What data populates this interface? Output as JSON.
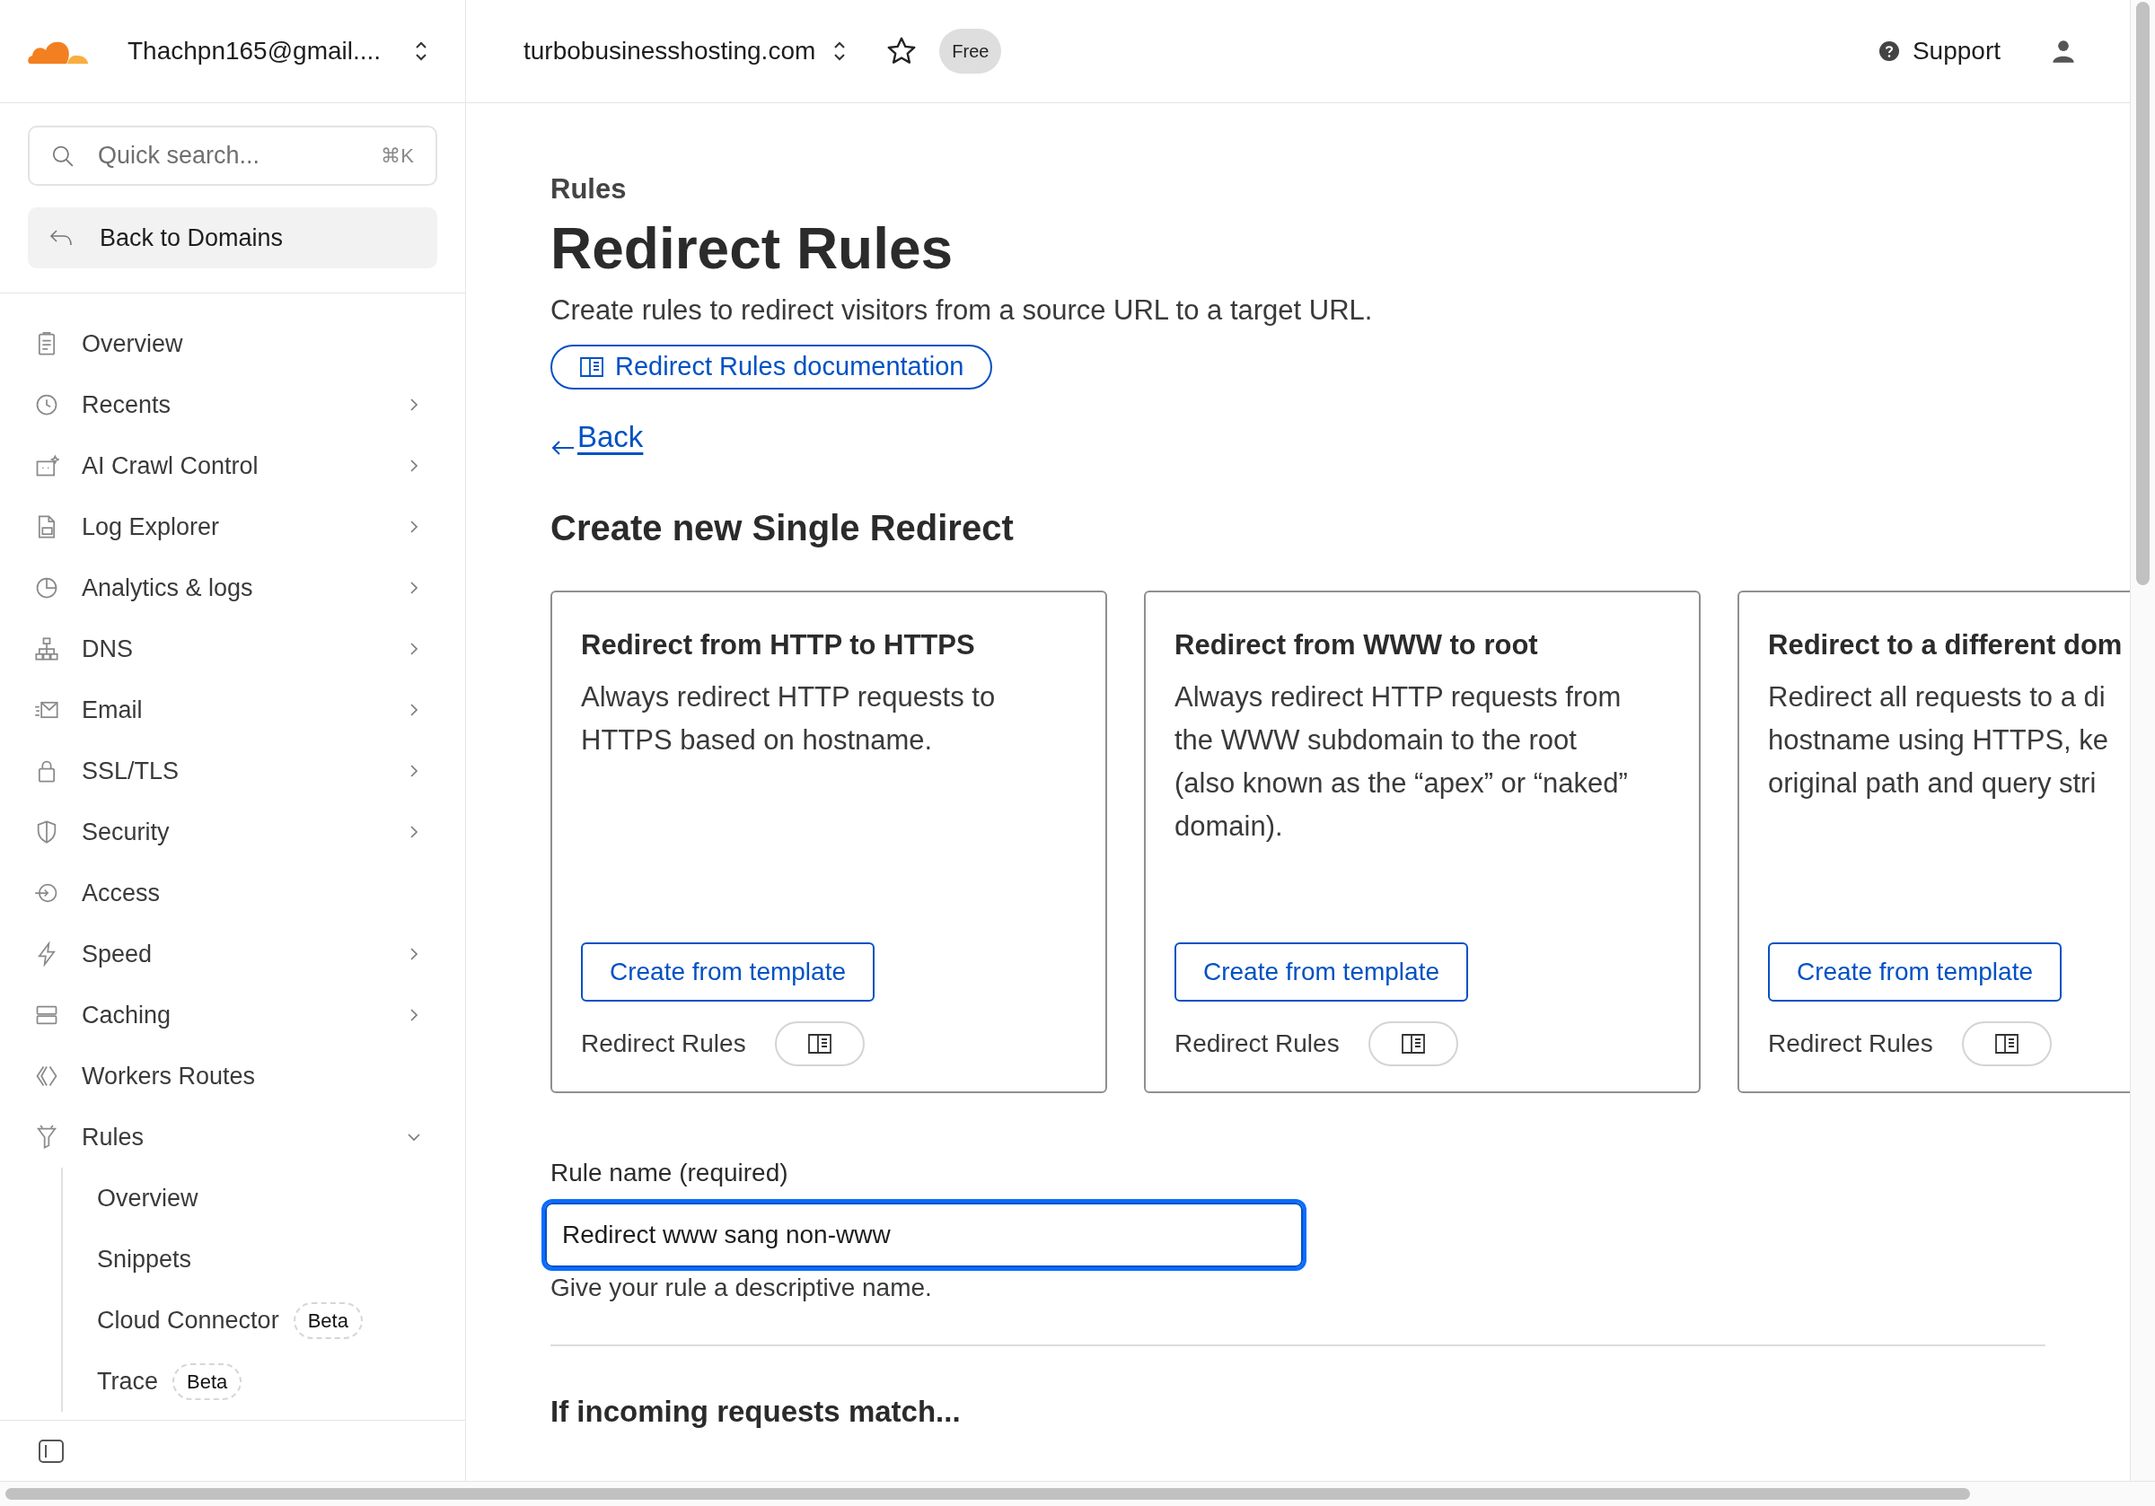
{
  "header": {
    "account": "Thachpn165@gmail....",
    "domain": "turbobusinesshosting.com",
    "plan_badge": "Free",
    "starred": false,
    "support": "Support"
  },
  "sidebar": {
    "search": {
      "placeholder": "Quick search...",
      "shortcut": "⌘K"
    },
    "back": "Back to Domains",
    "items": [
      {
        "label": "Overview"
      },
      {
        "label": "Recents",
        "expanded": false
      },
      {
        "label": "AI Crawl Control",
        "expanded": false
      },
      {
        "label": "Log Explorer",
        "expanded": false
      },
      {
        "label": "Analytics & logs",
        "expanded": false
      },
      {
        "label": "DNS",
        "expanded": false
      },
      {
        "label": "Email",
        "expanded": false
      },
      {
        "label": "SSL/TLS",
        "expanded": false
      },
      {
        "label": "Security",
        "expanded": false
      },
      {
        "label": "Access"
      },
      {
        "label": "Speed",
        "expanded": false
      },
      {
        "label": "Caching",
        "expanded": false
      },
      {
        "label": "Workers Routes"
      },
      {
        "label": "Rules",
        "expanded": true,
        "children": [
          {
            "label": "Overview"
          },
          {
            "label": "Snippets"
          },
          {
            "label": "Cloud Connector",
            "badge": "Beta"
          },
          {
            "label": "Trace",
            "badge": "Beta"
          }
        ]
      }
    ]
  },
  "page": {
    "eyebrow": "Rules",
    "title": "Redirect Rules",
    "description": "Create rules to redirect visitors from a source URL to a target URL.",
    "doc_link": "Redirect Rules documentation",
    "back": "Back",
    "section_title": "Create new Single Redirect",
    "cards": [
      {
        "title": "Redirect from HTTP to HTTPS",
        "lines": [
          "Always redirect HTTP requests to",
          "HTTPS based on hostname."
        ],
        "button": "Create from template",
        "footer": "Redirect Rules"
      },
      {
        "title": "Redirect from WWW to root",
        "lines": [
          "Always redirect HTTP requests from",
          "the WWW subdomain to the root",
          "(also known as the “apex” or “naked”",
          "domain)."
        ],
        "button": "Create from template",
        "footer": "Redirect Rules"
      },
      {
        "title": "Redirect to a different dom",
        "lines": [
          "Redirect all requests to a di",
          "hostname using HTTPS, ke",
          "original path and query stri"
        ],
        "button": "Create from template",
        "footer": "Redirect Rules"
      }
    ],
    "rule_name": {
      "label": "Rule name (required)",
      "value": "Redirect www sang non-www",
      "hint": "Give your rule a descriptive name.",
      "focused": true
    },
    "match_title": "If incoming requests match..."
  }
}
